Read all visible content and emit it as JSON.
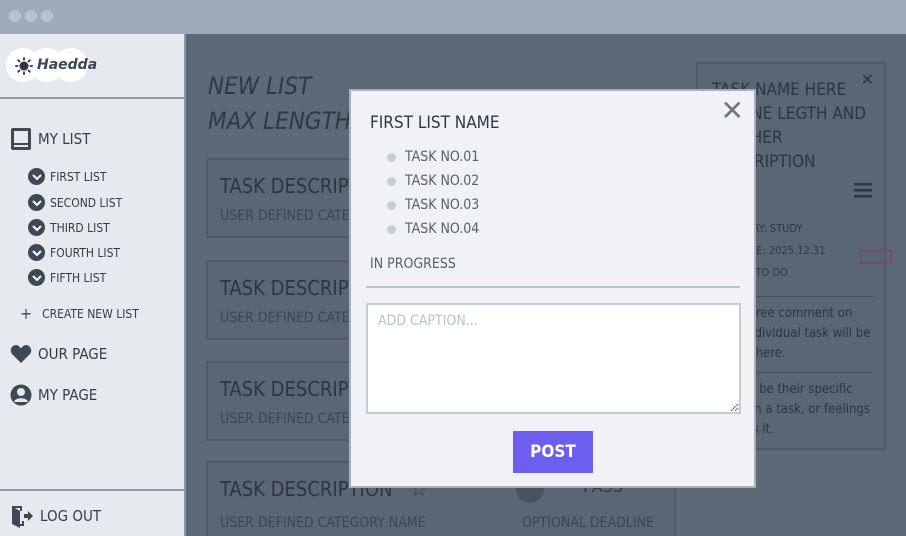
{
  "app": {
    "logo_text": "Haedda"
  },
  "sidebar": {
    "my_list_label": "MY LIST",
    "lists": [
      "FIRST LIST",
      "SECOND LIST",
      "THIRD LIST",
      "FOURTH LIST",
      "FIFTH LIST"
    ],
    "create_label": "CREATE NEW LIST",
    "our_page_label": "OUR PAGE",
    "my_page_label": "MY PAGE",
    "logout_label": "LOG OUT"
  },
  "main": {
    "title_line1": "NEW LIST",
    "title_line2": "MAX LENGTH",
    "cards": [
      {
        "title": "TASK DESCRIPTION",
        "category": "USER DEFINED CATEGORY NAME"
      },
      {
        "title": "TASK DESCRIPTION",
        "category": "USER DEFINED CATEGORY NAME"
      },
      {
        "title": "TASK DESCRIPTION",
        "category": "USER DEFINED CATEGORY NAME"
      },
      {
        "title": "TASK DESCRIPTION",
        "category": "USER DEFINED CATEGORY NAME",
        "pass_label": "PASS",
        "deadline": "OPTIONAL DEADLINE"
      }
    ]
  },
  "detail": {
    "title": "TASK NAME HERE TO LINE LEGTH AND FURTHER DESCRIPTION",
    "category": "CATEGORY: STUDY",
    "deadline": "DEADLINE: 2025.12.31",
    "status": "STATUS: TO DO",
    "comment1": "Users' free comment on each individual task will be posted here.",
    "comment2": "It could be their specific plans on a task, or feelings towards it."
  },
  "modal": {
    "title": "FIRST LIST NAME",
    "tasks": [
      "TASK NO.01",
      "TASK NO.02",
      "TASK NO.03",
      "TASK NO.04"
    ],
    "status": "IN PROGRESS",
    "caption_placeholder": "ADD CAPTION...",
    "post_label": "POST"
  },
  "colors": {
    "accent": "#6c5ff0",
    "sidebar_bg": "#e6e9ee",
    "overlay": "#5d6977"
  }
}
